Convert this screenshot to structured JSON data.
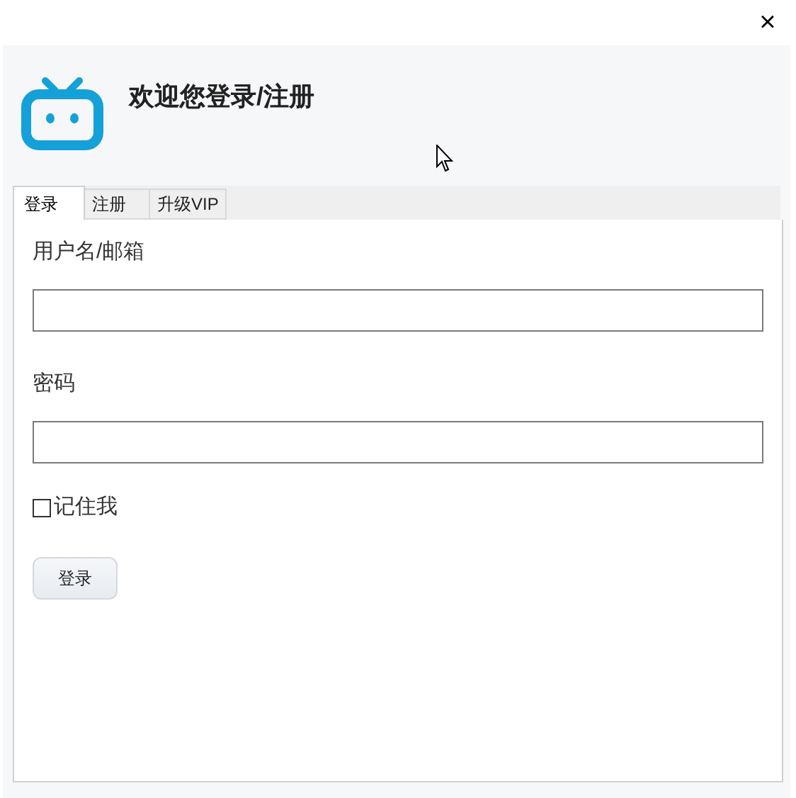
{
  "window": {
    "close": "×"
  },
  "header": {
    "title": "欢迎您登录/注册"
  },
  "tabs": [
    {
      "label": "登录",
      "selected": true
    },
    {
      "label": "注册",
      "selected": false
    },
    {
      "label": "升级VIP",
      "selected": false
    }
  ],
  "form": {
    "fields": [
      {
        "label": "用户名/邮箱"
      },
      {
        "label": "密码"
      }
    ],
    "remember": {
      "label": "记住我",
      "checked": false
    },
    "submit": "登录"
  }
}
